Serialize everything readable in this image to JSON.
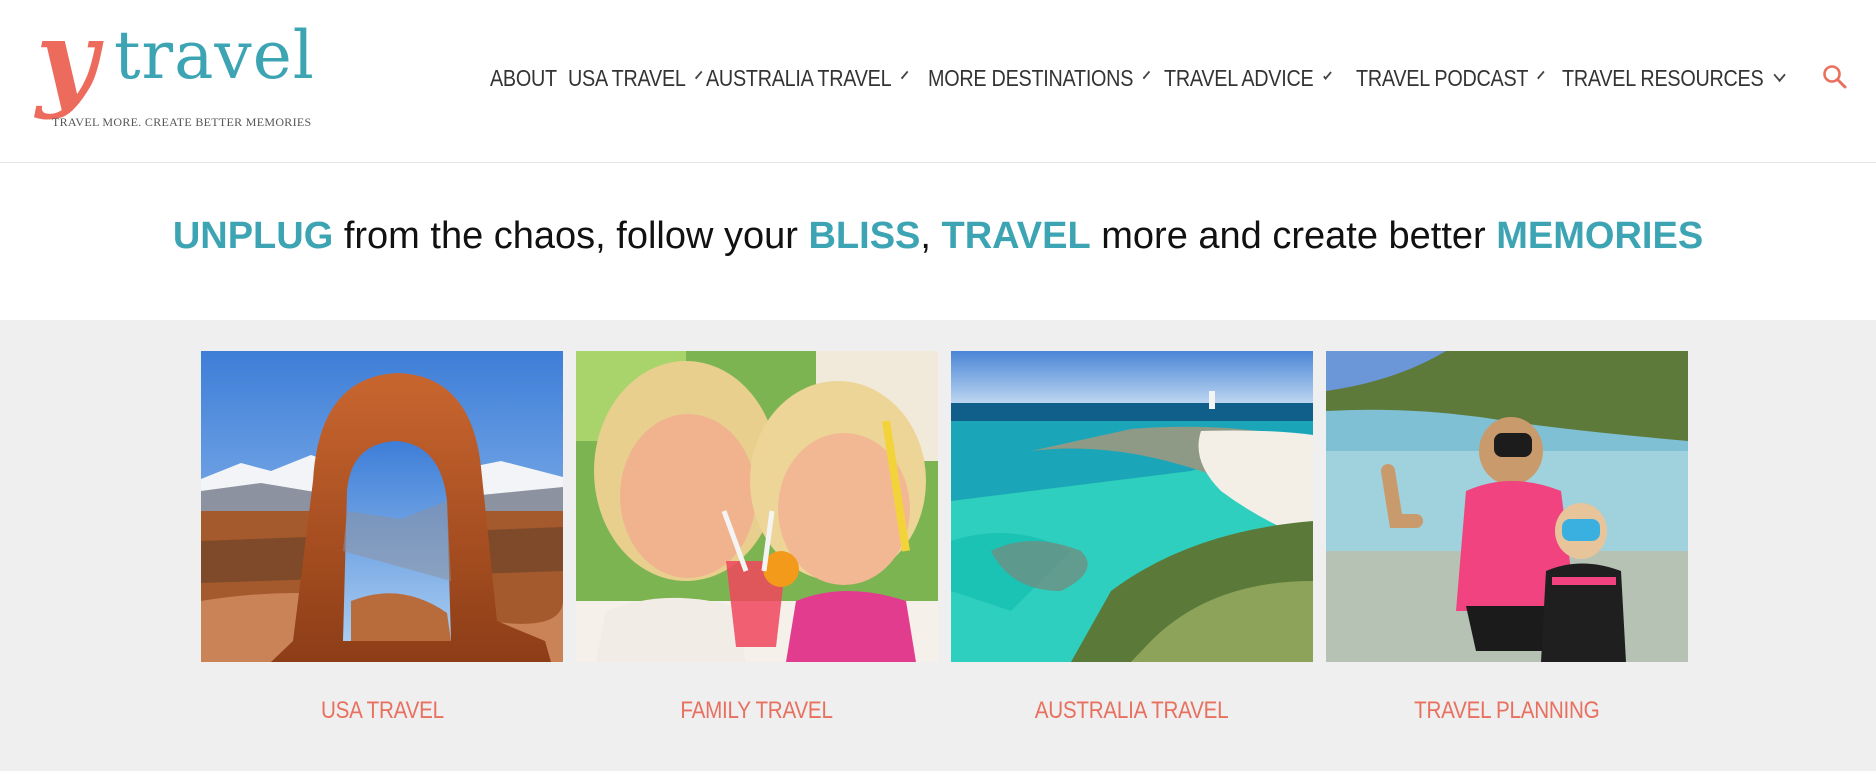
{
  "logo": {
    "y": "y",
    "word": "travel",
    "tagline": "TRAVEL MORE. CREATE BETTER MEMORIES"
  },
  "nav": {
    "items": [
      {
        "label": "ABOUT",
        "has_dropdown": false
      },
      {
        "label": "USA TRAVEL",
        "has_dropdown": true
      },
      {
        "label": "AUSTRALIA TRAVEL",
        "has_dropdown": true
      },
      {
        "label": "MORE DESTINATIONS",
        "has_dropdown": true
      },
      {
        "label": "TRAVEL ADVICE",
        "has_dropdown": true
      },
      {
        "label": "TRAVEL PODCAST",
        "has_dropdown": true
      },
      {
        "label": "TRAVEL RESOURCES",
        "has_dropdown": true
      }
    ],
    "search_icon": "search-icon"
  },
  "tagline": {
    "w1": "UNPLUG",
    "t1": " from the chaos, follow your ",
    "w2": "BLISS",
    "t2": ", ",
    "w3": "TRAVEL",
    "t3": " more and create better ",
    "w4": "MEMORIES"
  },
  "cards": [
    {
      "label": "USA TRAVEL",
      "image": "delicate-arch-photo"
    },
    {
      "label": "FAMILY TRAVEL",
      "image": "girls-drinking-photo"
    },
    {
      "label": "AUSTRALIA TRAVEL",
      "image": "coastline-aerial-photo"
    },
    {
      "label": "TRAVEL PLANNING",
      "image": "snorkel-beach-photo"
    }
  ],
  "colors": {
    "brand_teal": "#3ca4b3",
    "brand_coral": "#ec6b5d",
    "section_bg": "#efefef"
  }
}
